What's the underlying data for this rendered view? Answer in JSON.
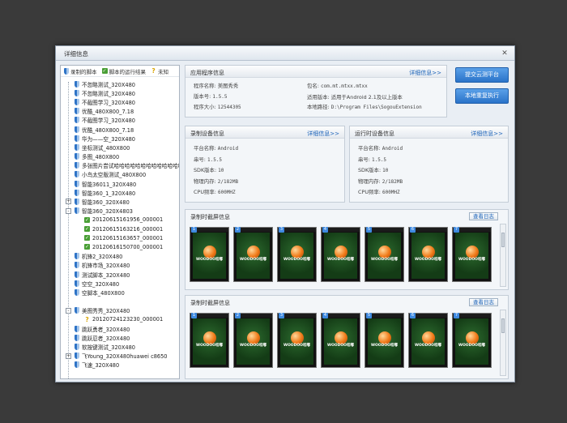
{
  "window": {
    "title": "详细信息"
  },
  "legend": {
    "recorded": "录制的脚本",
    "results": "脚本的运行结果",
    "unknown": "未知"
  },
  "tree": [
    {
      "label": "不忽略测试_320X480",
      "level": 0,
      "icon": "shield"
    },
    {
      "label": "不忽略测试_320X480",
      "level": 0,
      "icon": "shield"
    },
    {
      "label": "不截图学习_320X480",
      "level": 0,
      "icon": "shield"
    },
    {
      "label": "优酷_480X800_7.18",
      "level": 0,
      "icon": "shield"
    },
    {
      "label": "不截图学习_320X480",
      "level": 0,
      "icon": "shield"
    },
    {
      "label": "优酷_480X800_7.18",
      "level": 0,
      "icon": "shield"
    },
    {
      "label": "华为——空_320X480",
      "level": 0,
      "icon": "shield"
    },
    {
      "label": "坐标测试_480X800",
      "level": 0,
      "icon": "shield"
    },
    {
      "label": "多图_480X800",
      "level": 0,
      "icon": "shield"
    },
    {
      "label": "多张图片尝试哈哈哈哈哈哈哈哈哈哈哈哈哈最是的",
      "level": 0,
      "icon": "shield"
    },
    {
      "label": "小鸟太空版测试_480X800",
      "level": 0,
      "icon": "shield"
    },
    {
      "label": "智能36011_320X480",
      "level": 0,
      "icon": "shield"
    },
    {
      "label": "智能360_1_320X480",
      "level": 0,
      "icon": "shield"
    },
    {
      "label": "智能360_320X480",
      "level": 0,
      "icon": "shield",
      "expander": "+"
    },
    {
      "label": "智能360_320X4803",
      "level": 0,
      "icon": "shield",
      "expander": "-"
    },
    {
      "label": "20120615161956_000001",
      "level": 1,
      "icon": "check"
    },
    {
      "label": "20120615163216_000001",
      "level": 1,
      "icon": "check"
    },
    {
      "label": "20120615163657_000001",
      "level": 1,
      "icon": "check"
    },
    {
      "label": "20120616150700_000001",
      "level": 1,
      "icon": "check"
    },
    {
      "label": "机锋2_320X480",
      "level": 0,
      "icon": "shield"
    },
    {
      "label": "机锋市场_320X480",
      "level": 0,
      "icon": "shield"
    },
    {
      "label": "测试脚本_320X480",
      "level": 0,
      "icon": "shield"
    },
    {
      "label": "空空_320X480",
      "level": 0,
      "icon": "shield"
    },
    {
      "label": "空脚本_480X800",
      "level": 0,
      "icon": "shield"
    },
    {
      "label": "",
      "level": 0,
      "icon": "none"
    },
    {
      "label": "美图秀秀_320X480",
      "level": 0,
      "icon": "shield",
      "expander": "-"
    },
    {
      "label": "20120724123230_000001",
      "level": 1,
      "icon": "question"
    },
    {
      "label": "跳跃勇者_320X480",
      "level": 0,
      "icon": "shield"
    },
    {
      "label": "跳跃忍者_320X480",
      "level": 0,
      "icon": "shield"
    },
    {
      "label": "软按键测试_320X480",
      "level": 0,
      "icon": "shield"
    },
    {
      "label": "飞Young_320X480huawei c8650",
      "level": 0,
      "icon": "shield",
      "expander": "+"
    },
    {
      "label": "飞速_320X480",
      "level": 0,
      "icon": "shield"
    }
  ],
  "app_info": {
    "title": "应用程序信息",
    "more": "详细信息>>",
    "name_label": "程序名称:",
    "name": "美图秀秀",
    "version_label": "版本号:",
    "version": "1.5.5",
    "size_label": "程序大小:",
    "size": "12544305",
    "package_label": "包名:",
    "package": "com.mt.mtxx.mtxx",
    "sdk_label": "适用版本:",
    "sdk": "适用于Android 2.1及以上版本",
    "path_label": "本地路径:",
    "path": "D:\\Program Files\\SogouExtension"
  },
  "buttons": {
    "submit": "提交云测平台",
    "rerun": "本地重复执行"
  },
  "record_device": {
    "title": "录制设备信息",
    "more": "详细信息>>",
    "platform_label": "平台名称:",
    "platform": "Android",
    "serial_label": "串号:",
    "serial": "1.5.5",
    "sdk_label": "SDK版本:",
    "sdk": "10",
    "mem_label": "物理内存:",
    "mem": "2/182MB",
    "cpu_label": "CPU频率:",
    "cpu": "600MHZ"
  },
  "run_device": {
    "title": "运行时设备信息",
    "more": "详细信息>>",
    "platform_label": "平台名称:",
    "platform": "Android",
    "serial_label": "串号:",
    "serial": "1.5.5",
    "sdk_label": "SDK版本:",
    "sdk": "10",
    "mem_label": "物理内存:",
    "mem": "2/182MB",
    "cpu_label": "CPU频率:",
    "cpu": "600MHZ"
  },
  "screens1": {
    "title": "录制时截屏信息",
    "log": "查看日志",
    "thumbs": [
      "1",
      "2",
      "3",
      "4",
      "5",
      "6",
      "7"
    ],
    "logo": "WOODOO哇嘟"
  },
  "screens2": {
    "title": "录制时截屏信息",
    "log": "查看日志",
    "thumbs": [
      "1",
      "2",
      "3",
      "4",
      "5",
      "6",
      "7"
    ],
    "logo": "WOODOO哇嘟"
  }
}
